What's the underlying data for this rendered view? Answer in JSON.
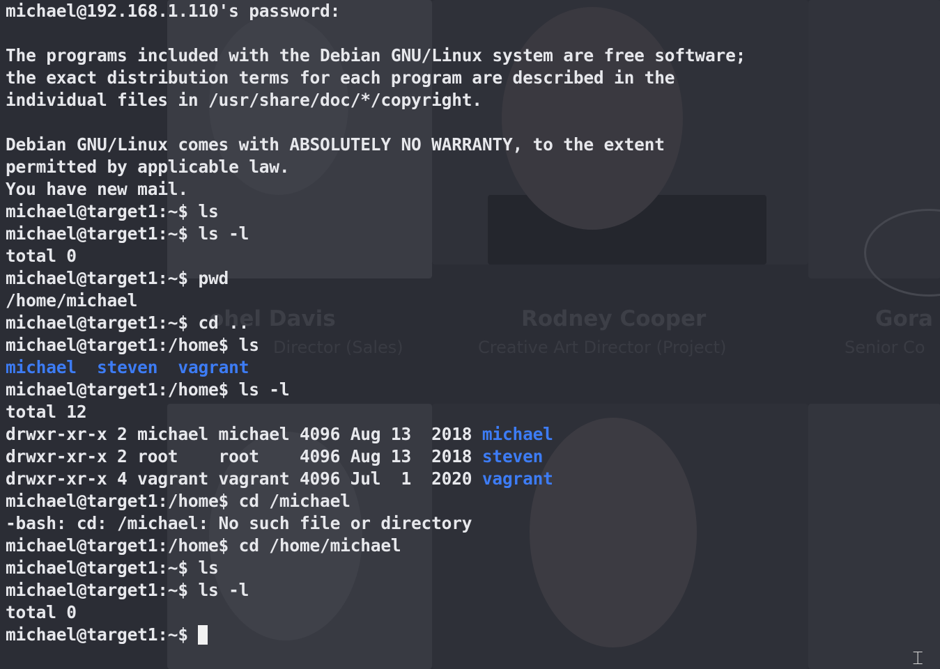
{
  "terminal": {
    "lines": [
      "michael@192.168.1.110's password:",
      "",
      "The programs included with the Debian GNU/Linux system are free software;",
      "the exact distribution terms for each program are described in the",
      "individual files in /usr/share/doc/*/copyright.",
      "",
      "Debian GNU/Linux comes with ABSOLUTELY NO WARRANTY, to the extent",
      "permitted by applicable law.",
      "You have new mail.",
      "michael@target1:~$ ls",
      "michael@target1:~$ ls -l",
      "total 0",
      "michael@target1:~$ pwd",
      "/home/michael",
      "michael@target1:~$ cd ..",
      "michael@target1:/home$ ls"
    ],
    "ls_dirs": [
      "michael",
      "steven",
      "vagrant"
    ],
    "ls_dir_sep": "  ",
    "after_ls": [
      "michael@target1:/home$ ls -l",
      "total 12"
    ],
    "long_listing": [
      {
        "prefix": "drwxr-xr-x 2 michael michael 4096 Aug 13  2018 ",
        "name": "michael"
      },
      {
        "prefix": "drwxr-xr-x 2 root    root    4096 Aug 13  2018 ",
        "name": "steven"
      },
      {
        "prefix": "drwxr-xr-x 4 vagrant vagrant 4096 Jul  1  2020 ",
        "name": "vagrant"
      }
    ],
    "tail": [
      "michael@target1:/home$ cd /michael",
      "-bash: cd: /michael: No such file or directory",
      "michael@target1:/home$ cd /home/michael",
      "michael@target1:~$ ls",
      "michael@target1:~$ ls -l",
      "total 0"
    ],
    "prompt": "michael@target1:~$ ",
    "colors": {
      "background": "#2b2d35",
      "text": "#e7e8ec",
      "directory": "#3d7cf5"
    }
  },
  "background_page": {
    "names": [
      "ohel Davis",
      "Rodney Cooper",
      "Gora"
    ],
    "roles": [
      "Director (Sales)",
      "Creative Art Director (Project)",
      "Senior Co"
    ]
  },
  "icons": {
    "cursor": "text-ibeam-icon"
  }
}
